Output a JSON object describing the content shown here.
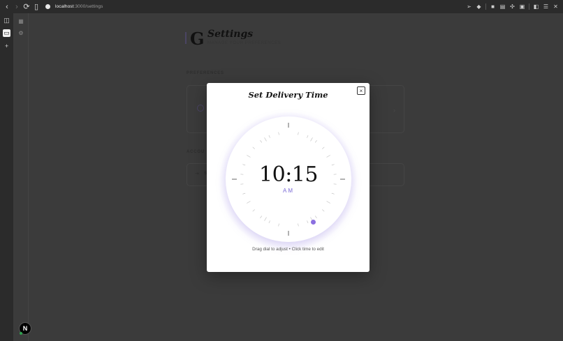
{
  "browser": {
    "url_host": "localhost",
    "url_path": ":3000/settings"
  },
  "page": {
    "brand_letter": "G",
    "title": "Settings",
    "subtitle": "MANAGE YOUR PREFERENCES",
    "preferences_label": "PREFERENCES",
    "account_label": "ACCOU",
    "signout_initial": "S",
    "avatar_letter": "N"
  },
  "modal": {
    "title": "Set Delivery Time",
    "time": "10:15",
    "period": "AM",
    "hint": "Drag dial to adjust • Click time to edit",
    "close_glyph": "×",
    "handle_minute": 25,
    "accent_color": "#8b6fe0"
  }
}
